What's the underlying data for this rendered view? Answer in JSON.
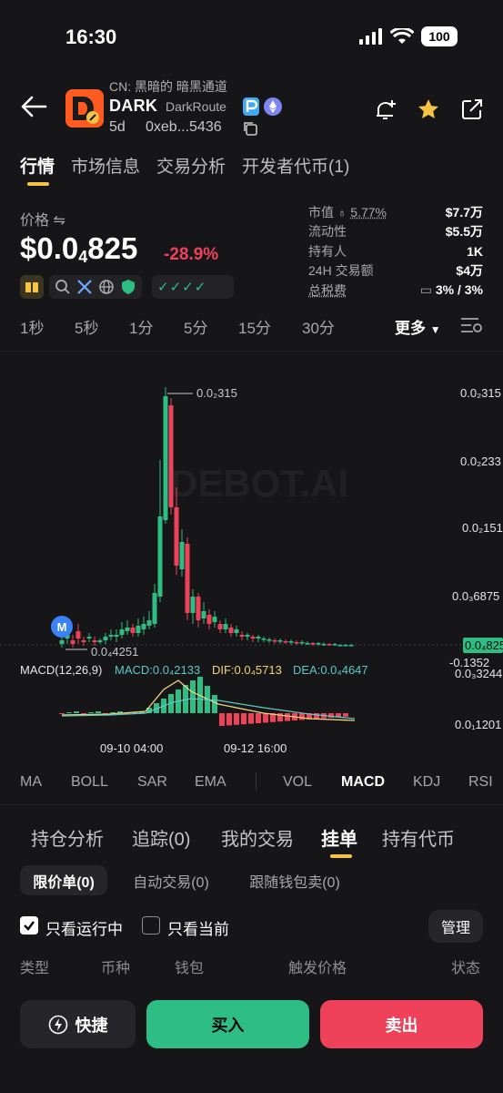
{
  "status": {
    "time": "16:30",
    "battery": "100"
  },
  "token": {
    "cn_name": "CN: 黑暗的 暗黑通道",
    "symbol": "DARK",
    "full_name": "DarkRoute",
    "age": "5d",
    "address": "0xeb...5436"
  },
  "main_tabs": [
    "行情",
    "市场信息",
    "交易分析",
    "开发者代币(1)"
  ],
  "price": {
    "label": "价格",
    "integer": "$0.0",
    "zeros": "4",
    "digits": "825",
    "change": "-28.9%"
  },
  "stats": [
    {
      "label": "市值",
      "extra": "5.77%",
      "value": "$7.7万"
    },
    {
      "label": "流动性",
      "value": "$5.5万"
    },
    {
      "label": "持有人",
      "value": "1K"
    },
    {
      "label": "24H 交易额",
      "value": "$4万"
    },
    {
      "label": "总税费",
      "value": "3% / 3%"
    }
  ],
  "timeframes": [
    "1秒",
    "5秒",
    "1分",
    "5分",
    "15分",
    "30分"
  ],
  "more_label": "更多",
  "chart_data": {
    "type": "candlestick",
    "watermark": "DEBOT.AI",
    "y_tick_labels": [
      "0.0₂315",
      "0.0₂233",
      "0.0₂151",
      "0.0₃6875",
      "0.0₄8255",
      "-0.1352",
      "0.0₃3244",
      "0.0₁1201"
    ],
    "x_tick_labels": [
      "09-10 04:00",
      "09-12 16:00"
    ],
    "high_annotation": "0.0₂315",
    "low_annotation": "0.0₄4251",
    "current_price_label": "0.0₄8255",
    "marker": "M",
    "macd_legend": {
      "name": "MACD(12,26,9)",
      "macd": "MACD:0.0₄2133",
      "dif": "DIF:0.0₄5713",
      "dea": "DEA:0.0₄4647"
    },
    "colors": {
      "up": "#2ebd85",
      "down": "#f0415b",
      "dif": "#f2d47a",
      "dea": "#5fc8c0"
    }
  },
  "indicators": [
    "MA",
    "BOLL",
    "SAR",
    "EMA",
    "VOL",
    "MACD",
    "KDJ",
    "RSI"
  ],
  "sub_tabs": [
    "持仓分析",
    "追踪(0)",
    "我的交易",
    "挂单",
    "持有代币"
  ],
  "order_pills": [
    "限价单(0)",
    "自动交易(0)",
    "跟随钱包卖(0)"
  ],
  "filters": {
    "running": "只看运行中",
    "current": "只看当前",
    "manage": "管理"
  },
  "columns": [
    "类型",
    "币种",
    "钱包",
    "触发价格",
    "状态"
  ],
  "actions": {
    "quick": "快捷",
    "buy": "买入",
    "sell": "卖出"
  }
}
